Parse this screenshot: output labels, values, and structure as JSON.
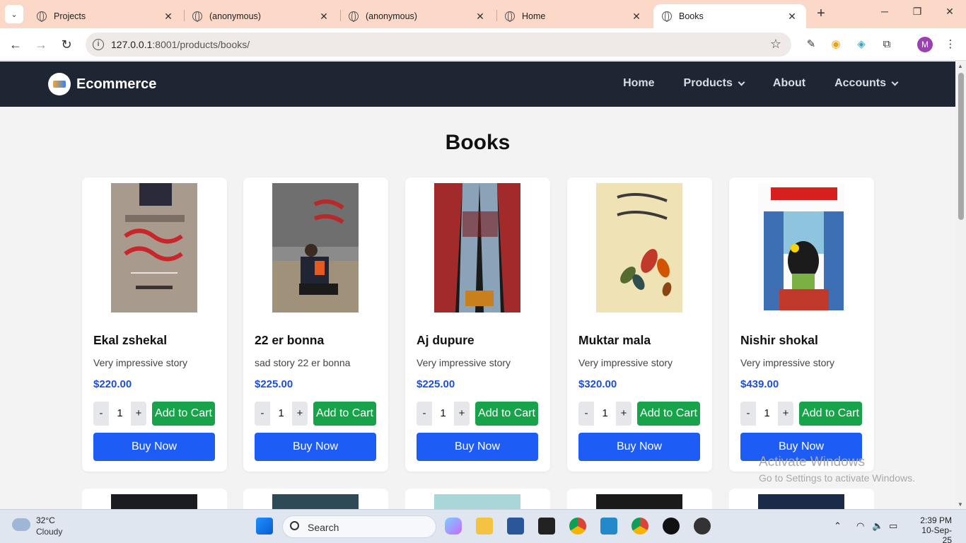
{
  "browser": {
    "tabs": [
      {
        "title": "Projects",
        "active": false
      },
      {
        "title": "(anonymous)",
        "active": false
      },
      {
        "title": "(anonymous)",
        "active": false
      },
      {
        "title": "Home",
        "active": false
      },
      {
        "title": "Books",
        "active": true
      }
    ],
    "url_host": "127.0.0.1",
    "url_rest": ":8001/products/books/",
    "profile_initial": "M"
  },
  "site": {
    "brand": "Ecommerce",
    "nav": {
      "home": "Home",
      "products": "Products",
      "about": "About",
      "accounts": "Accounts"
    }
  },
  "page": {
    "title": "Books",
    "quantity_default": "1",
    "minus_label": "-",
    "plus_label": "+",
    "add_to_cart_label": "Add to Cart",
    "buy_now_label": "Buy Now",
    "products": [
      {
        "name": "Ekal zshekal",
        "description": "Very impressive story",
        "price": "$220.00"
      },
      {
        "name": "22 er bonna",
        "description": "sad story 22 er bonna",
        "price": "$225.00"
      },
      {
        "name": "Aj dupure",
        "description": "Very impressive story",
        "price": "$225.00"
      },
      {
        "name": "Muktar mala",
        "description": "Very impressive story",
        "price": "$320.00"
      },
      {
        "name": "Nishir shokal",
        "description": "Very impressive story",
        "price": "$439.00"
      }
    ]
  },
  "watermark": {
    "line1": "Activate Windows",
    "line2": "Go to Settings to activate Windows."
  },
  "taskbar": {
    "temperature": "32°C",
    "condition": "Cloudy",
    "search_label": "Search",
    "time": "2:39 PM",
    "date": "10-Sep-25"
  },
  "colors": {
    "navbar_bg": "#1e2533",
    "add_to_cart": "#16a34a",
    "buy_now": "#1d5cf5",
    "price": "#1d4ed8",
    "tabstrip": "#fbd8c7"
  }
}
